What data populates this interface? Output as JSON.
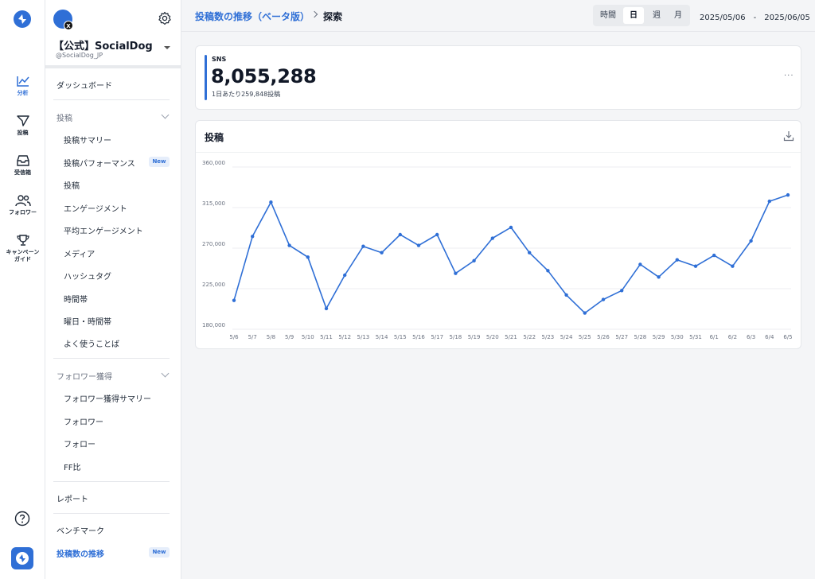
{
  "rail": {
    "items": [
      {
        "label": "分析",
        "icon": "analytics-icon"
      },
      {
        "label": "投稿",
        "icon": "send-icon"
      },
      {
        "label": "受信箱",
        "icon": "inbox-icon"
      },
      {
        "label": "フォロワー",
        "icon": "followers-icon"
      },
      {
        "label": "キャンペーン",
        "label2": "ガイド",
        "icon": "trophy-icon"
      }
    ]
  },
  "account": {
    "name": "【公式】SocialDog",
    "handle": "@SocialDog_JP",
    "network_badge": "X"
  },
  "sidebar": {
    "dashboard": "ダッシュボード",
    "posts_group": "投稿",
    "posts_items": [
      "投稿サマリー",
      "投稿パフォーマンス",
      "投稿",
      "エンゲージメント",
      "平均エンゲージメント",
      "メディア",
      "ハッシュタグ",
      "時間帯",
      "曜日・時間帯",
      "よく使うことば"
    ],
    "follower_group": "フォロワー獲得",
    "follower_items": [
      "フォロワー獲得サマリー",
      "フォロワー",
      "フォロー",
      "FF比"
    ],
    "report": "レポート",
    "benchmark": "ベンチマーク",
    "post_trend": "投稿数の推移",
    "new_badge": "New"
  },
  "header": {
    "crumb_parent": "投稿数の推移（ベータ版）",
    "crumb_current": "探索",
    "granularity": [
      "時間",
      "日",
      "週",
      "月"
    ],
    "granularity_selected": "日",
    "date_range": "2025/05/06　-　2025/06/05"
  },
  "stat": {
    "label": "SNS",
    "value": "8,055,288",
    "sub": "1日あたり259,848投稿",
    "more": "···"
  },
  "chart_card": {
    "title": "投稿"
  },
  "colors": {
    "accent": "#2f6fd6",
    "line": "#2f6fd6"
  },
  "chart_data": {
    "type": "line",
    "title": "投稿",
    "categories": [
      "5/6",
      "5/7",
      "5/8",
      "5/9",
      "5/10",
      "5/11",
      "5/12",
      "5/13",
      "5/14",
      "5/15",
      "5/16",
      "5/17",
      "5/18",
      "5/19",
      "5/20",
      "5/21",
      "5/22",
      "5/23",
      "5/24",
      "5/25",
      "5/26",
      "5/27",
      "5/28",
      "5/29",
      "5/30",
      "5/31",
      "6/1",
      "6/2",
      "6/3",
      "6/4",
      "6/5"
    ],
    "values": [
      212000,
      283000,
      321000,
      273000,
      260000,
      203000,
      240000,
      272000,
      265000,
      285000,
      273000,
      285000,
      242000,
      256000,
      281000,
      293000,
      265000,
      245000,
      218000,
      198000,
      213000,
      223000,
      252000,
      238000,
      257000,
      250000,
      262000,
      250000,
      278000,
      322000,
      329000
    ],
    "y_ticks": [
      "360,000",
      "315,000",
      "270,000",
      "225,000",
      "180,000"
    ],
    "ylim": [
      180000,
      360000
    ],
    "grid": true,
    "legend": "none"
  }
}
